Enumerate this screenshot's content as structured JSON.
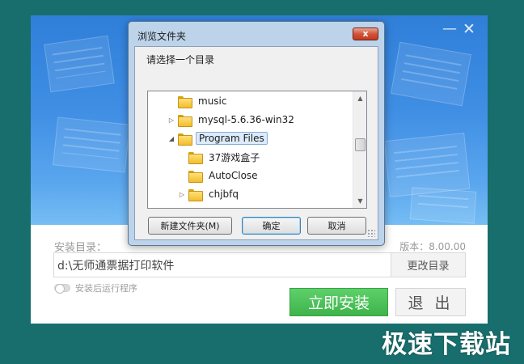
{
  "installer": {
    "minimize_icon": "minimize-icon",
    "close_icon": "close-icon",
    "minimize_glyph": "—",
    "close_glyph": "✕",
    "dir_label": "安装目录：",
    "version_label": "版本：8.00.00",
    "path_value": "d:\\无师通票据打印软件",
    "change_dir_label": "更改目录",
    "run_after_label": "安装后运行程序",
    "install_label": "立即安装",
    "exit_label": "退 出",
    "colors": {
      "install_green": "#3eb44b",
      "banner_blue": "#3f8ee4",
      "background": "#176e6c"
    }
  },
  "dialog": {
    "title": "浏览文件夹",
    "close_glyph": "x",
    "prompt": "请选择一个目录",
    "tree": [
      {
        "label": "music",
        "expander": "",
        "selected": false
      },
      {
        "label": "mysql-5.6.36-win32",
        "expander": "▷",
        "selected": false
      },
      {
        "label": "Program Files",
        "expander": "◢",
        "selected": true
      },
      {
        "label": "37游戏盒子",
        "expander": "",
        "selected": false
      },
      {
        "label": "AutoClose",
        "expander": "",
        "selected": false
      },
      {
        "label": "chjbfq",
        "expander": "▷",
        "selected": false
      }
    ],
    "scroll_up_glyph": "▲",
    "scroll_down_glyph": "▼",
    "new_folder_label": "新建文件夹(M)",
    "ok_label": "确定",
    "cancel_label": "取消"
  },
  "watermark": "极速下载站"
}
